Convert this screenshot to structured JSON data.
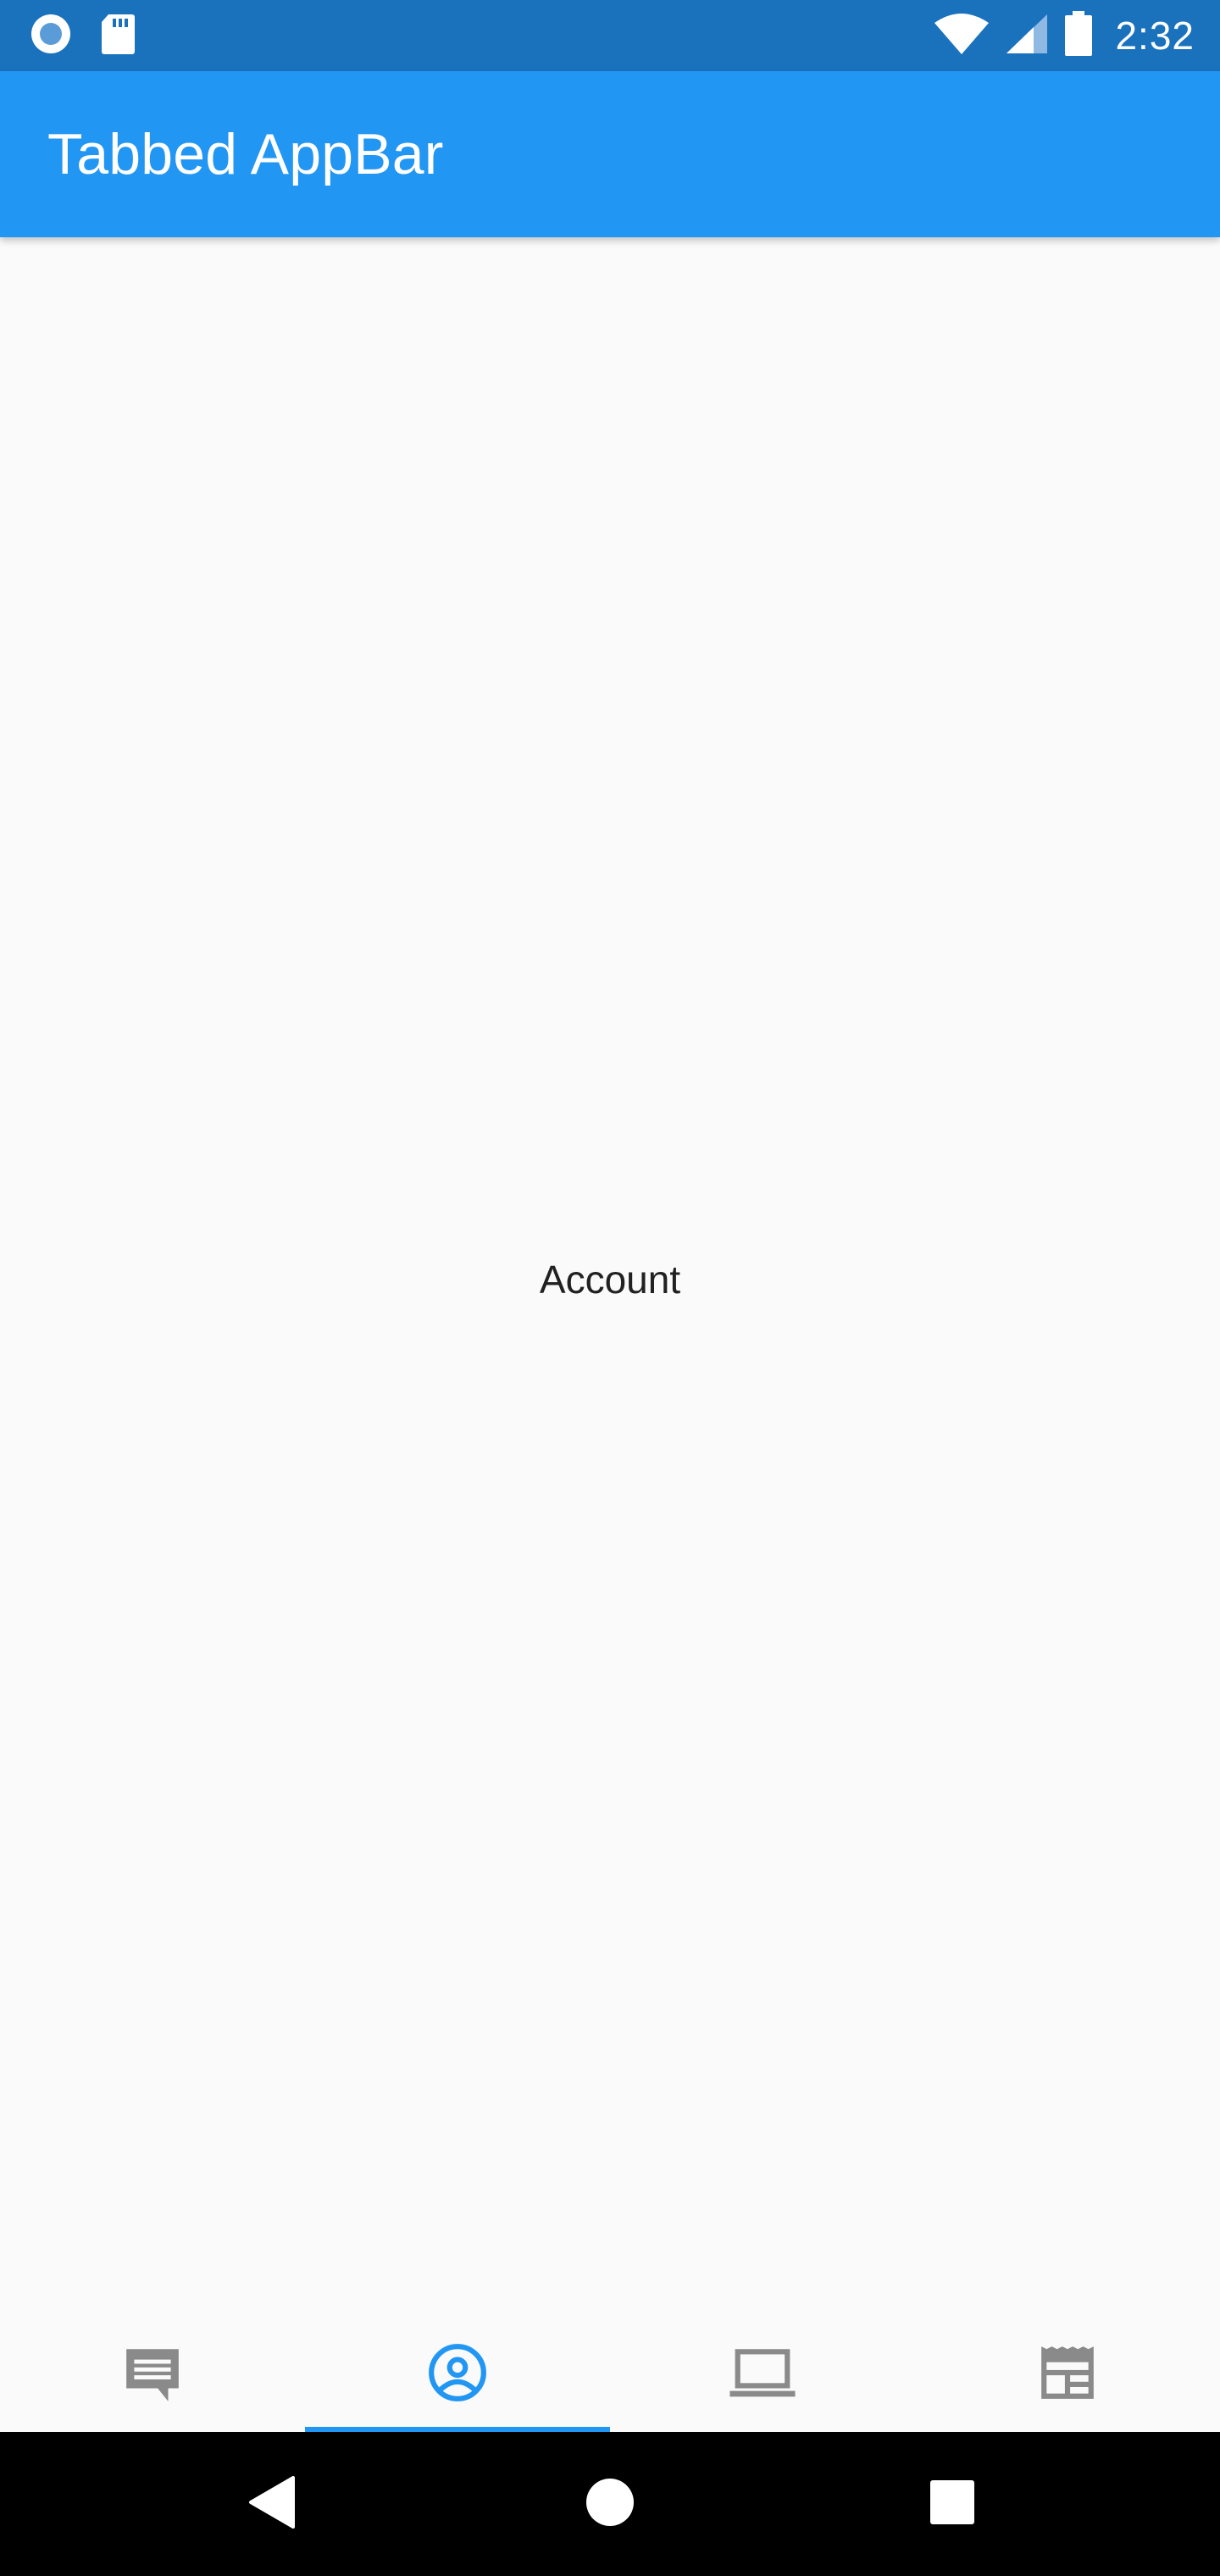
{
  "status_bar": {
    "time": "2:32",
    "left_icons": [
      "record-icon",
      "sd-card-icon"
    ],
    "right_icons": [
      "wifi-icon",
      "cell-signal-icon",
      "battery-icon"
    ]
  },
  "app_bar": {
    "title": "Tabbed AppBar",
    "color": "#2196f3"
  },
  "main": {
    "text": "Account"
  },
  "tabs": [
    {
      "icon": "chat-icon",
      "selected": false
    },
    {
      "icon": "account-circle-icon",
      "selected": true
    },
    {
      "icon": "laptop-icon",
      "selected": false
    },
    {
      "icon": "web-layout-icon",
      "selected": false
    }
  ],
  "colors": {
    "accent": "#2196f3",
    "status_bar": "#1a72bd",
    "inactive_icon": "#8a8a8a"
  },
  "nav_bar": {
    "buttons": [
      "back-icon",
      "home-icon",
      "recents-icon"
    ]
  }
}
